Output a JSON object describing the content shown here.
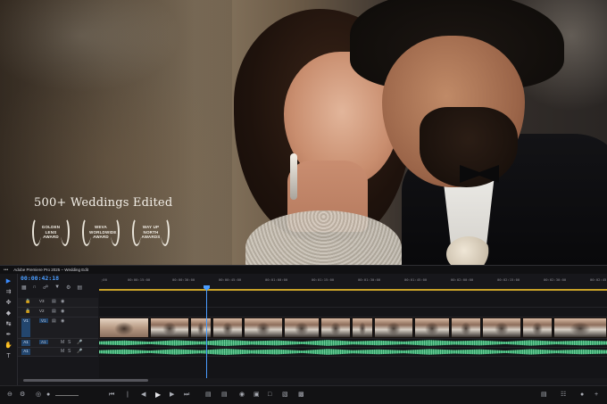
{
  "hero": {
    "headline": "500+ Weddings Edited",
    "awards": [
      {
        "lines": [
          "GOLDEN",
          "LENS",
          "AWARD"
        ]
      },
      {
        "lines": [
          "WEVA",
          "WORLDWIDE",
          "AWARD"
        ]
      },
      {
        "lines": [
          "WAY UP",
          "NORTH",
          "AWARDS"
        ]
      }
    ]
  },
  "editor": {
    "window_title": "Adobe Premiere Pro 2025 – Wedding Edit",
    "menu_glyph": "•••",
    "timecode": "00:00:42:18",
    "header_icons": [
      "nest-icon",
      "snap-icon",
      "link-icon",
      "marker-icon",
      "wrench-icon",
      "captions-icon"
    ],
    "ruler_ticks": [
      ";00",
      "00:00:15:00",
      "00:00:30:00",
      "00:00:45:00",
      "00:01:00:00",
      "00:01:15:00",
      "00:01:30:00",
      "00:01:45:00",
      "00:02:00:00",
      "00:02:15:00",
      "00:02:30:00",
      "00:02:45"
    ],
    "tracks": [
      {
        "id": "V3",
        "kind": "video",
        "patch": ""
      },
      {
        "id": "V2",
        "kind": "video",
        "patch": ""
      },
      {
        "id": "V1",
        "kind": "video",
        "patch": "V1"
      },
      {
        "id": "A1",
        "kind": "audio",
        "patch": "A1"
      },
      {
        "id": "A2",
        "kind": "audio",
        "patch": "A1"
      }
    ],
    "tools": [
      "selection-tool",
      "track-select-tool",
      "ripple-edit-tool",
      "razor-tool",
      "slip-tool",
      "pen-tool",
      "hand-tool",
      "type-tool"
    ],
    "accent_color": "#4a9dff",
    "audio_color": "#2a9a63",
    "workarea_color": "#c9a227"
  }
}
